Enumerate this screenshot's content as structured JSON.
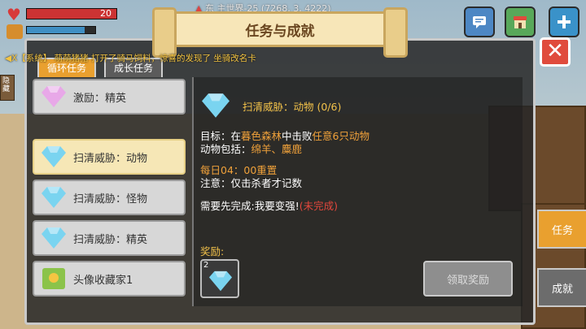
{
  "hud": {
    "hp_value": "20",
    "hp_fraction": 1.0,
    "food_fraction": 0.85,
    "heart_icon": "heart-icon",
    "food_icon": "food-icon",
    "coords_text": "东 主世界-25 (7268, 3, 4222)"
  },
  "top_buttons": [
    "chat-icon",
    "shop-icon",
    "add-icon"
  ],
  "system_message": "◀X【系统】 萌萌猪猪 打开了骑马饲料，惊喜的发现了 坐骑改名卡",
  "side_tab_text": "隐藏",
  "dialog": {
    "title": "任务与成就",
    "close_symbol": "✕",
    "tabs": {
      "cycle": "循环任务",
      "growth": "成长任务"
    }
  },
  "task_list": [
    {
      "label": "激励：精英",
      "gem_color": "#e8a8e8"
    },
    {
      "label": "扫清威胁：动物",
      "gem_color": "#7ad4f0",
      "selected": true
    },
    {
      "label": "扫清威胁：怪物",
      "gem_color": "#7ad4f0"
    },
    {
      "label": "扫清威胁：精英",
      "gem_color": "#7ad4f0"
    },
    {
      "label": "头像收藏家1",
      "gem_color": "#8bc34a"
    }
  ],
  "detail": {
    "title": "扫清威胁：动物 (0/6)",
    "goal_prefix": "目标：在",
    "goal_place": "暮色森林",
    "goal_mid": "中击败",
    "goal_target": "任意6只动物",
    "animals_prefix": "动物包括：",
    "animals": "绵羊、麋鹿",
    "reset": "每日04：00重置",
    "note": "注意：仅击杀者才记数",
    "prereq_prefix": "需要先完成:我要变强!",
    "prereq_status": "(未完成)",
    "reward_label": "奖励:",
    "reward_count": "2",
    "claim_label": "领取奖励"
  },
  "side_nav": {
    "task": "任务",
    "achieve": "成就"
  }
}
